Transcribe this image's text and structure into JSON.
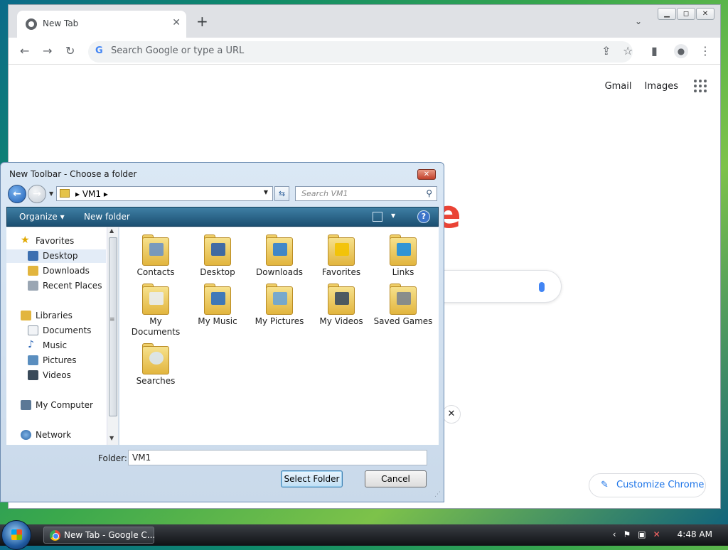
{
  "browser": {
    "tab_title": "New Tab",
    "tab_close": "✕",
    "new_tab": "+",
    "tab_list": "⌄",
    "window_buttons": [
      "▁",
      "◻",
      "✕"
    ],
    "omnibox_placeholder": "Search Google or type a URL",
    "omnibox_google": "G",
    "links": {
      "gmail": "Gmail",
      "images": "Images"
    },
    "logo_partial": "e",
    "close_x": "✕",
    "customize_label": "Customize Chrome",
    "customize_icon": "✎"
  },
  "dialog": {
    "title": "New Toolbar - Choose a folder",
    "close": "✕",
    "address_path": "▸  VM1  ▸",
    "search_placeholder": "Search VM1",
    "commands": {
      "organize": "Organize ▾",
      "new_folder": "New folder"
    },
    "help": "?",
    "nav": {
      "favorites": "Favorites",
      "desktop": "Desktop",
      "downloads": "Downloads",
      "recent": "Recent Places",
      "libraries": "Libraries",
      "documents": "Documents",
      "music": "Music",
      "pictures": "Pictures",
      "videos": "Videos",
      "computer": "My Computer",
      "network": "Network"
    },
    "folders": [
      {
        "label": "Contacts"
      },
      {
        "label": "Desktop"
      },
      {
        "label": "Downloads"
      },
      {
        "label": "Favorites"
      },
      {
        "label": "Links"
      },
      {
        "label": "My Documents"
      },
      {
        "label": "My Music"
      },
      {
        "label": "My Pictures"
      },
      {
        "label": "My Videos"
      },
      {
        "label": "Saved Games"
      },
      {
        "label": "Searches"
      }
    ],
    "folder_label": "Folder:",
    "folder_value": "VM1",
    "select_button": "Select Folder",
    "cancel_button": "Cancel"
  },
  "taskbar": {
    "task_label": "New Tab - Google C...",
    "clock": "4:48 AM"
  },
  "colors": {
    "accent": "#1a73e8",
    "dialog_cmdbar": "#1b4f72"
  }
}
